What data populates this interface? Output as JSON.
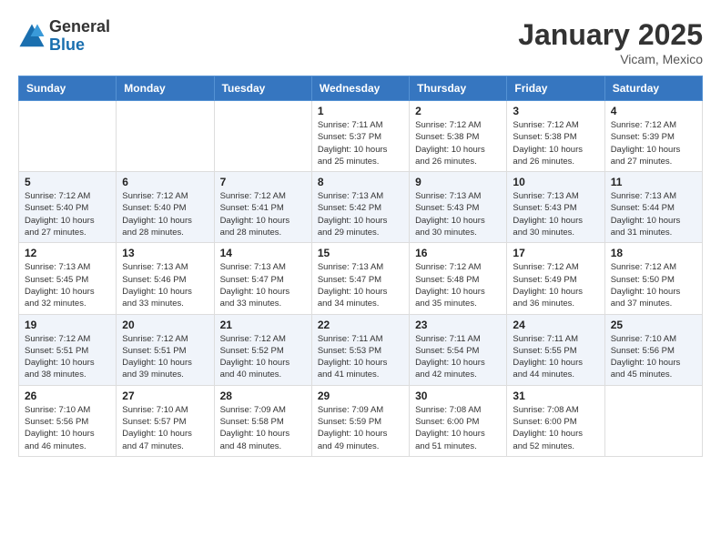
{
  "header": {
    "logo": {
      "general": "General",
      "blue": "Blue"
    },
    "title": "January 2025",
    "location": "Vicam, Mexico"
  },
  "calendar": {
    "days_of_week": [
      "Sunday",
      "Monday",
      "Tuesday",
      "Wednesday",
      "Thursday",
      "Friday",
      "Saturday"
    ],
    "weeks": [
      [
        {
          "day": "",
          "info": ""
        },
        {
          "day": "",
          "info": ""
        },
        {
          "day": "",
          "info": ""
        },
        {
          "day": "1",
          "info": "Sunrise: 7:11 AM\nSunset: 5:37 PM\nDaylight: 10 hours\nand 25 minutes."
        },
        {
          "day": "2",
          "info": "Sunrise: 7:12 AM\nSunset: 5:38 PM\nDaylight: 10 hours\nand 26 minutes."
        },
        {
          "day": "3",
          "info": "Sunrise: 7:12 AM\nSunset: 5:38 PM\nDaylight: 10 hours\nand 26 minutes."
        },
        {
          "day": "4",
          "info": "Sunrise: 7:12 AM\nSunset: 5:39 PM\nDaylight: 10 hours\nand 27 minutes."
        }
      ],
      [
        {
          "day": "5",
          "info": "Sunrise: 7:12 AM\nSunset: 5:40 PM\nDaylight: 10 hours\nand 27 minutes."
        },
        {
          "day": "6",
          "info": "Sunrise: 7:12 AM\nSunset: 5:40 PM\nDaylight: 10 hours\nand 28 minutes."
        },
        {
          "day": "7",
          "info": "Sunrise: 7:12 AM\nSunset: 5:41 PM\nDaylight: 10 hours\nand 28 minutes."
        },
        {
          "day": "8",
          "info": "Sunrise: 7:13 AM\nSunset: 5:42 PM\nDaylight: 10 hours\nand 29 minutes."
        },
        {
          "day": "9",
          "info": "Sunrise: 7:13 AM\nSunset: 5:43 PM\nDaylight: 10 hours\nand 30 minutes."
        },
        {
          "day": "10",
          "info": "Sunrise: 7:13 AM\nSunset: 5:43 PM\nDaylight: 10 hours\nand 30 minutes."
        },
        {
          "day": "11",
          "info": "Sunrise: 7:13 AM\nSunset: 5:44 PM\nDaylight: 10 hours\nand 31 minutes."
        }
      ],
      [
        {
          "day": "12",
          "info": "Sunrise: 7:13 AM\nSunset: 5:45 PM\nDaylight: 10 hours\nand 32 minutes."
        },
        {
          "day": "13",
          "info": "Sunrise: 7:13 AM\nSunset: 5:46 PM\nDaylight: 10 hours\nand 33 minutes."
        },
        {
          "day": "14",
          "info": "Sunrise: 7:13 AM\nSunset: 5:47 PM\nDaylight: 10 hours\nand 33 minutes."
        },
        {
          "day": "15",
          "info": "Sunrise: 7:13 AM\nSunset: 5:47 PM\nDaylight: 10 hours\nand 34 minutes."
        },
        {
          "day": "16",
          "info": "Sunrise: 7:12 AM\nSunset: 5:48 PM\nDaylight: 10 hours\nand 35 minutes."
        },
        {
          "day": "17",
          "info": "Sunrise: 7:12 AM\nSunset: 5:49 PM\nDaylight: 10 hours\nand 36 minutes."
        },
        {
          "day": "18",
          "info": "Sunrise: 7:12 AM\nSunset: 5:50 PM\nDaylight: 10 hours\nand 37 minutes."
        }
      ],
      [
        {
          "day": "19",
          "info": "Sunrise: 7:12 AM\nSunset: 5:51 PM\nDaylight: 10 hours\nand 38 minutes."
        },
        {
          "day": "20",
          "info": "Sunrise: 7:12 AM\nSunset: 5:51 PM\nDaylight: 10 hours\nand 39 minutes."
        },
        {
          "day": "21",
          "info": "Sunrise: 7:12 AM\nSunset: 5:52 PM\nDaylight: 10 hours\nand 40 minutes."
        },
        {
          "day": "22",
          "info": "Sunrise: 7:11 AM\nSunset: 5:53 PM\nDaylight: 10 hours\nand 41 minutes."
        },
        {
          "day": "23",
          "info": "Sunrise: 7:11 AM\nSunset: 5:54 PM\nDaylight: 10 hours\nand 42 minutes."
        },
        {
          "day": "24",
          "info": "Sunrise: 7:11 AM\nSunset: 5:55 PM\nDaylight: 10 hours\nand 44 minutes."
        },
        {
          "day": "25",
          "info": "Sunrise: 7:10 AM\nSunset: 5:56 PM\nDaylight: 10 hours\nand 45 minutes."
        }
      ],
      [
        {
          "day": "26",
          "info": "Sunrise: 7:10 AM\nSunset: 5:56 PM\nDaylight: 10 hours\nand 46 minutes."
        },
        {
          "day": "27",
          "info": "Sunrise: 7:10 AM\nSunset: 5:57 PM\nDaylight: 10 hours\nand 47 minutes."
        },
        {
          "day": "28",
          "info": "Sunrise: 7:09 AM\nSunset: 5:58 PM\nDaylight: 10 hours\nand 48 minutes."
        },
        {
          "day": "29",
          "info": "Sunrise: 7:09 AM\nSunset: 5:59 PM\nDaylight: 10 hours\nand 49 minutes."
        },
        {
          "day": "30",
          "info": "Sunrise: 7:08 AM\nSunset: 6:00 PM\nDaylight: 10 hours\nand 51 minutes."
        },
        {
          "day": "31",
          "info": "Sunrise: 7:08 AM\nSunset: 6:00 PM\nDaylight: 10 hours\nand 52 minutes."
        },
        {
          "day": "",
          "info": ""
        }
      ]
    ]
  }
}
